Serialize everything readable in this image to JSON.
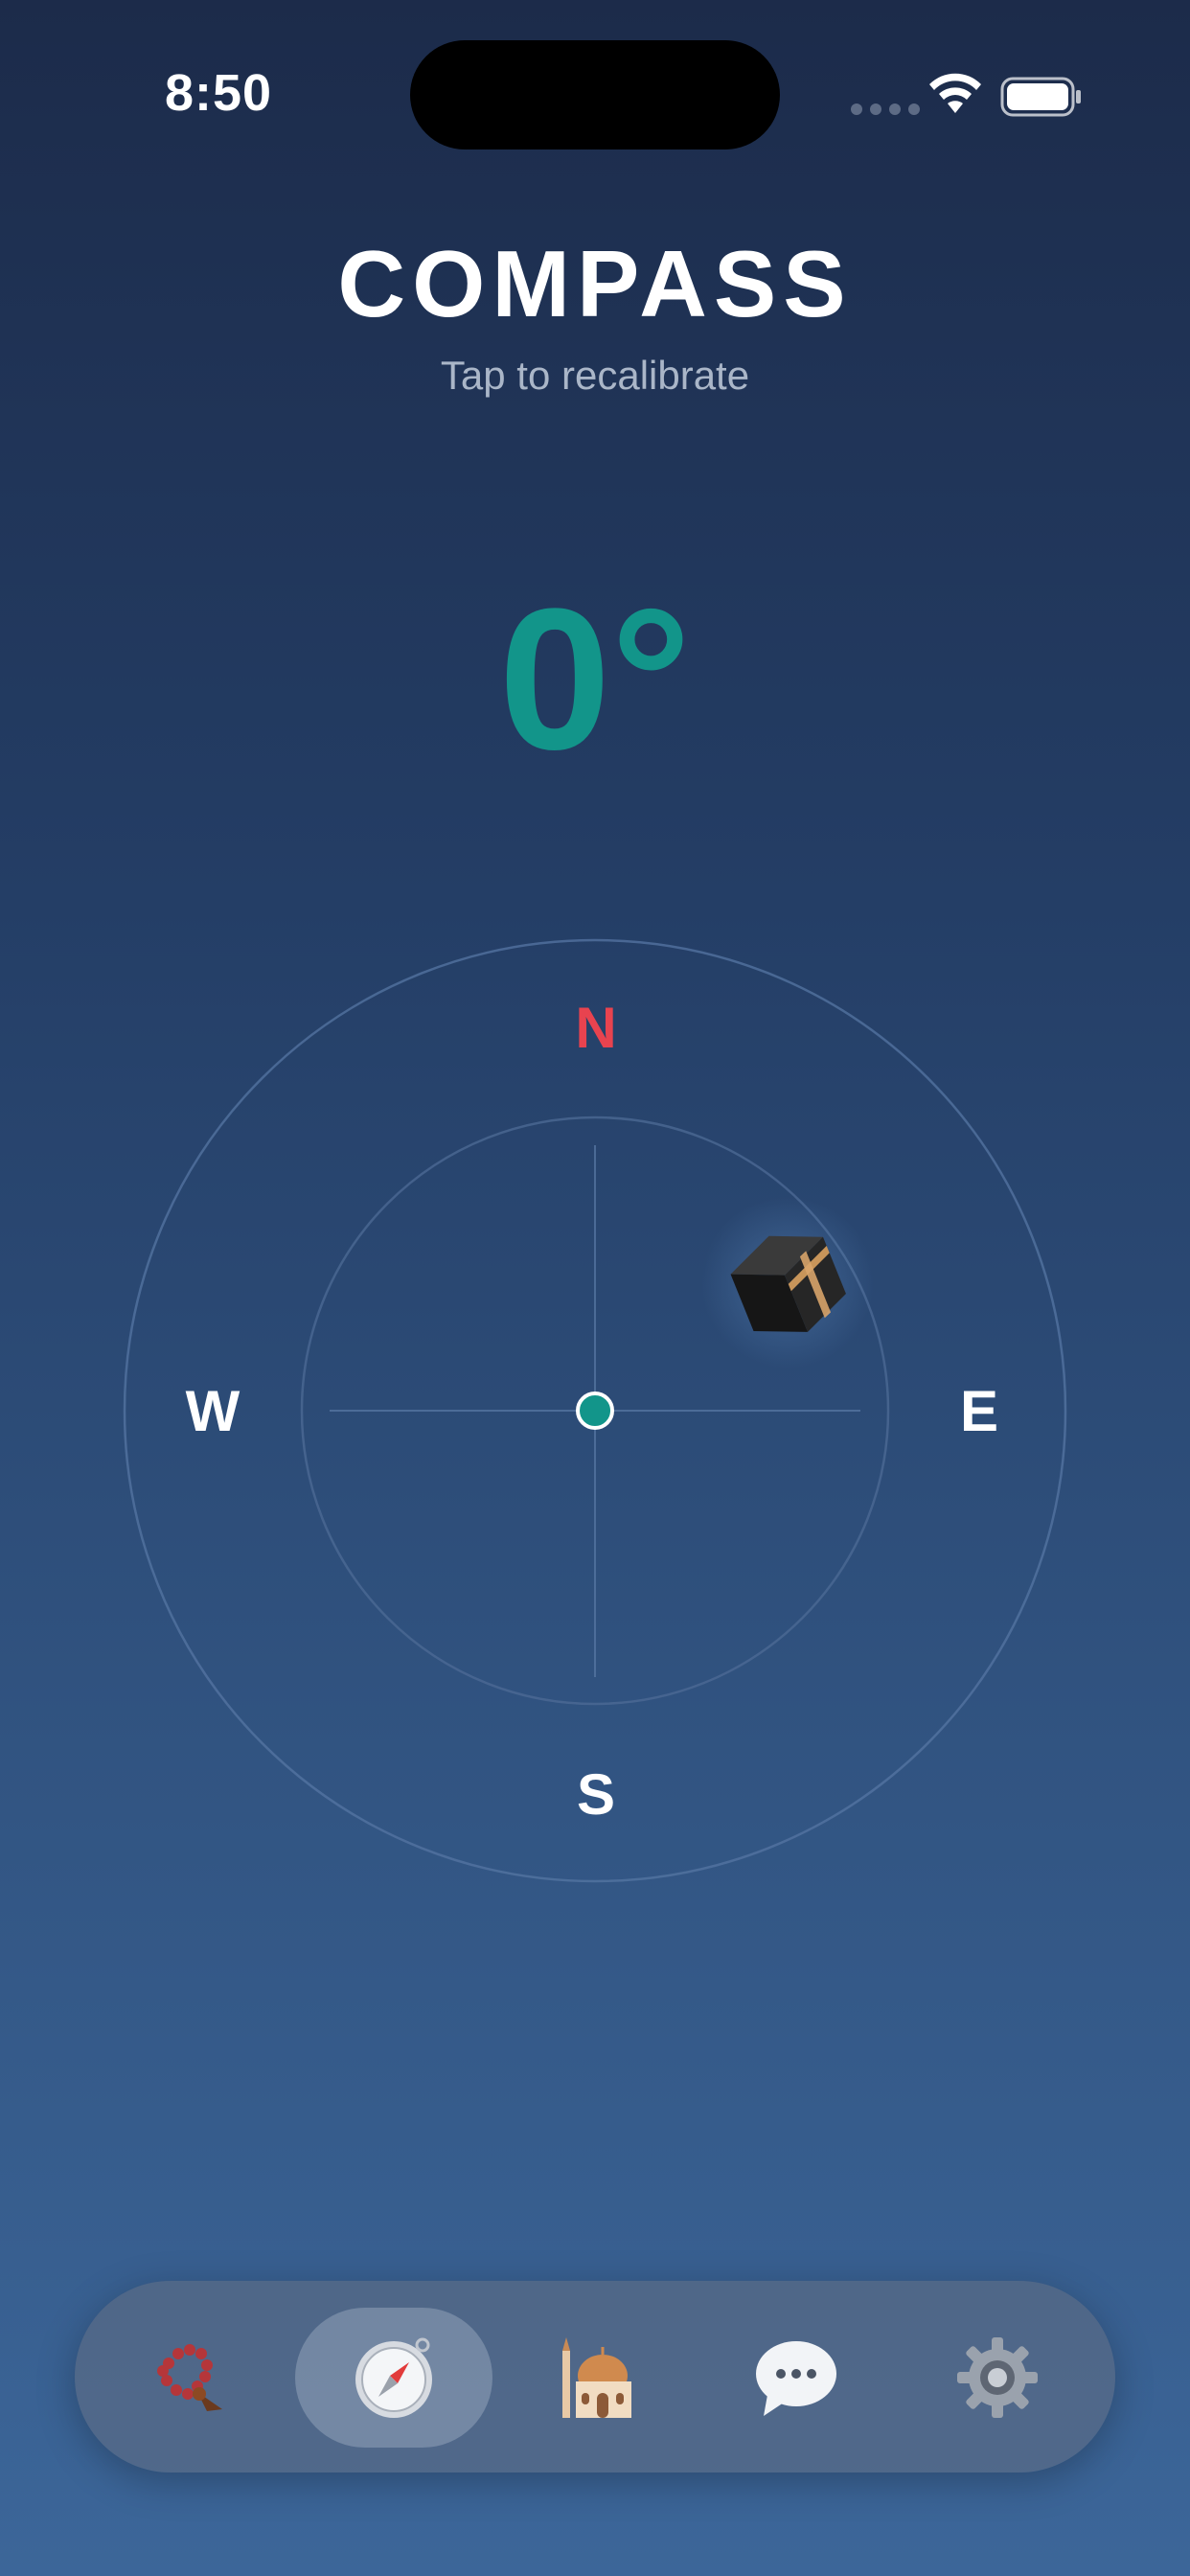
{
  "status_bar": {
    "time": "8:50",
    "icons": [
      "signal-icon",
      "wifi-icon",
      "battery-icon"
    ]
  },
  "header": {
    "title": "COMPASS",
    "subtitle": "Tap to recalibrate"
  },
  "heading": {
    "value": "0°"
  },
  "compass": {
    "north": "N",
    "south": "S",
    "west": "W",
    "east": "E",
    "qibla_icon": "kaaba-icon",
    "colors": {
      "north": "#e8434f",
      "heading": "#12958a",
      "center_dot": "#12958a"
    }
  },
  "tab_bar": {
    "tabs": [
      {
        "icon": "prayer-beads-icon",
        "active": false
      },
      {
        "icon": "compass-icon",
        "active": true
      },
      {
        "icon": "mosque-icon",
        "active": false
      },
      {
        "icon": "chat-bubble-icon",
        "active": false
      },
      {
        "icon": "gear-icon",
        "active": false
      }
    ]
  }
}
